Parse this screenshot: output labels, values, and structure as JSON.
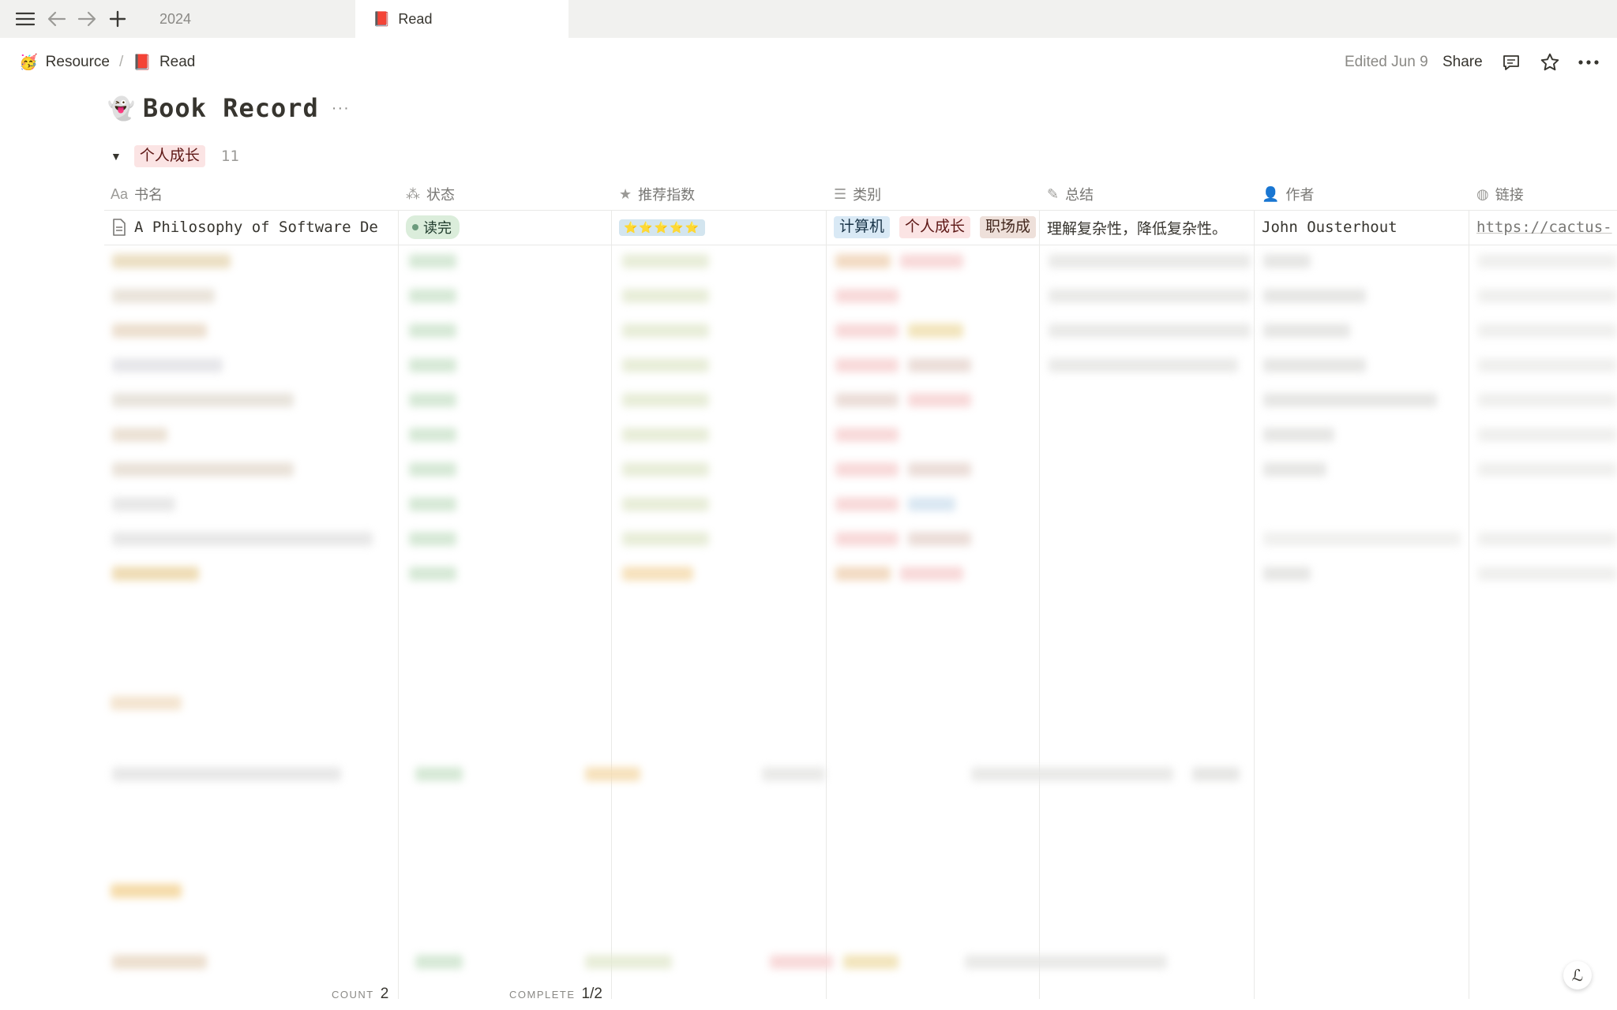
{
  "titlebar": {
    "tabs": [
      {
        "label": "2024",
        "emoji": ""
      },
      {
        "label": "Read",
        "emoji": "📕"
      }
    ]
  },
  "breadcrumb": {
    "items": [
      {
        "emoji": "🥳",
        "label": "Resource"
      },
      {
        "emoji": "📕",
        "label": "Read"
      }
    ],
    "separator": "/"
  },
  "header": {
    "edited": "Edited Jun 9",
    "share": "Share"
  },
  "page": {
    "emoji": "👻",
    "title": "Book Record",
    "more": "···"
  },
  "group": {
    "name": "个人成长",
    "count": "11"
  },
  "columns": [
    {
      "icon": "Aa",
      "label": "书名"
    },
    {
      "icon": "⁂",
      "label": "状态"
    },
    {
      "icon": "★",
      "label": "推荐指数"
    },
    {
      "icon": "☰",
      "label": "类别"
    },
    {
      "icon": "✎",
      "label": "总结"
    },
    {
      "icon": "👤",
      "label": "作者"
    },
    {
      "icon": "◍",
      "label": "链接"
    }
  ],
  "first_row": {
    "title": "A Philosophy of Software De",
    "status": "读完",
    "rating": "⭐⭐⭐⭐⭐",
    "categories": [
      "计算机",
      "个人成长",
      "职场成"
    ],
    "summary": "理解复杂性，降低复杂性。",
    "author": "John Ousterhout",
    "link": "https://cactus-"
  },
  "footer": {
    "count_label": "COUNT",
    "count_value": "2",
    "complete_label": "COMPLETE",
    "complete_value": "1/2"
  },
  "colors": {
    "accent_red_tag": "#fbe4e4",
    "status_green": "#dbeddb",
    "blue_tag": "#d9e9f5"
  }
}
